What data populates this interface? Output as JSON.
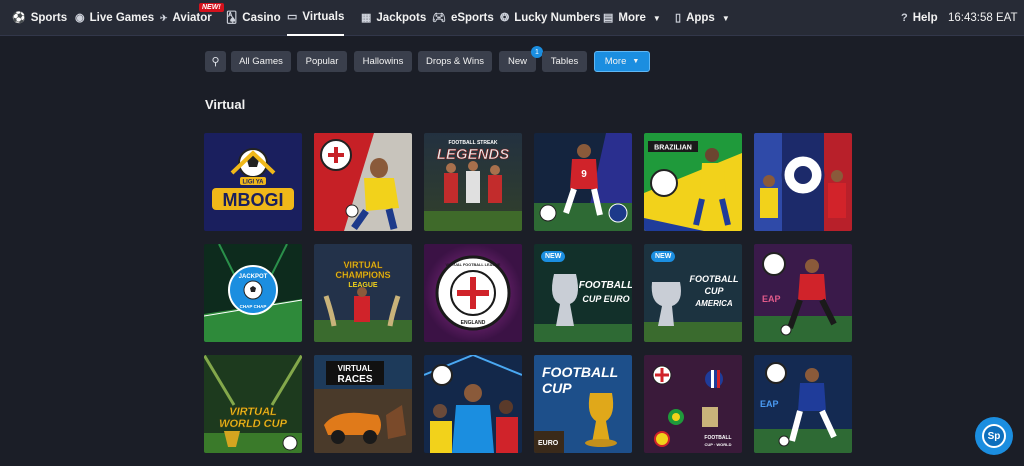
{
  "nav": {
    "sports": {
      "label": "Sports",
      "icon": "soccer-ball-icon"
    },
    "live_games": {
      "label": "Live Games",
      "icon": "live-icon"
    },
    "aviator": {
      "label": "Aviator",
      "icon": "plane-icon",
      "badge": "NEW!"
    },
    "casino": {
      "label": "Casino",
      "icon": "cards-icon"
    },
    "virtuals": {
      "label": "Virtuals",
      "icon": "monitor-icon"
    },
    "jackpots": {
      "label": "Jackpots",
      "icon": "grid-icon"
    },
    "esports": {
      "label": "eSports",
      "icon": "gamepad-icon"
    },
    "lucky_numbers": {
      "label": "Lucky Numbers",
      "icon": "lucky-icon"
    },
    "more": {
      "label": "More"
    },
    "apps": {
      "label": "Apps",
      "icon": "phone-icon"
    },
    "help": {
      "label": "Help",
      "icon": "help-icon"
    },
    "time": "16:43:58 EAT"
  },
  "filters": {
    "chips": [
      "All Games",
      "Popular",
      "Hallowins",
      "Drops & Wins",
      "New",
      "Tables",
      "More"
    ],
    "new_count": "1"
  },
  "section_title": "Virtual",
  "tiles": [
    {
      "name": "ligi-ya-mbogi",
      "text": [
        "LIGI YA",
        "MBOGI"
      ]
    },
    {
      "name": "virtual-football-league-spain",
      "text": []
    },
    {
      "name": "football-streak-legends",
      "text": [
        "FOOTBALL STREAK",
        "LEGENDS"
      ]
    },
    {
      "name": "virtual-football-league-9",
      "text": []
    },
    {
      "name": "brazilian-league",
      "text": [
        "BRAZILIAN"
      ]
    },
    {
      "name": "football-streak-champions",
      "text": []
    },
    {
      "name": "jackpot-chap-chap",
      "text": [
        "JACKPOT",
        "CHAP CHAP"
      ]
    },
    {
      "name": "virtual-champions-league",
      "text": [
        "VIRTUAL",
        "CHAMPIONS",
        "LEAGUE"
      ]
    },
    {
      "name": "virtual-football-league-england",
      "text": [
        "VIRTUAL FOOTBALL LEAGUE",
        "ENGLAND"
      ]
    },
    {
      "name": "football-cup-euro",
      "text": [
        "NEW",
        "FOOTBALL",
        "CUP EURO"
      ]
    },
    {
      "name": "football-cup-america",
      "text": [
        "NEW",
        "FOOTBALL",
        "CUP",
        "AMERICA"
      ]
    },
    {
      "name": "virtual-league-red-striker",
      "text": [
        "EAP"
      ]
    },
    {
      "name": "virtual-world-cup",
      "text": [
        "VIRTUAL",
        "WORLD CUP"
      ]
    },
    {
      "name": "virtual-races",
      "text": [
        "VIRTUAL",
        "RACES"
      ]
    },
    {
      "name": "virtual-football-stars",
      "text": []
    },
    {
      "name": "football-cup-trophy",
      "text": [
        "FOOTBALL",
        "CUP",
        "EURO"
      ]
    },
    {
      "name": "football-cup-world",
      "text": [
        "FOOTBALL",
        "CUP · WORLD"
      ]
    },
    {
      "name": "virtual-league-blue-striker",
      "text": [
        "EAP"
      ]
    }
  ],
  "chat": {
    "label": "Sp"
  }
}
